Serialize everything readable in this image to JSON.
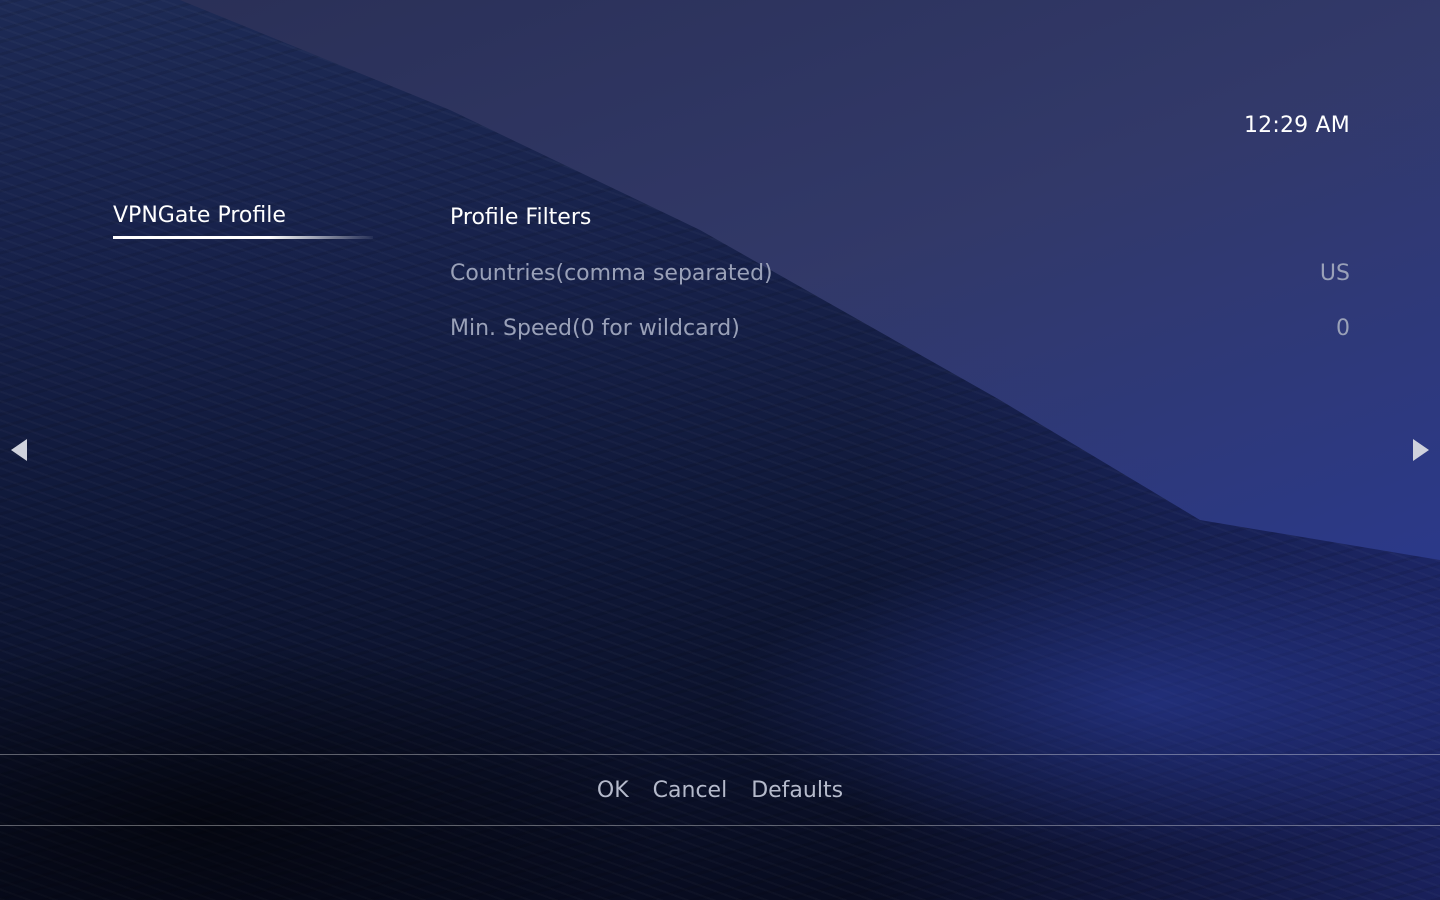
{
  "status": {
    "clock": "12:29 AM"
  },
  "categories": [
    {
      "label": "VPNGate Profile",
      "selected": true
    }
  ],
  "settings": {
    "section_title": "Profile Filters",
    "rows": [
      {
        "label": "Countries(comma separated)",
        "value": "US"
      },
      {
        "label": "Min. Speed(0 for wildcard)",
        "value": "0"
      }
    ]
  },
  "nav": {
    "left_icon": "arrow-left-icon",
    "right_icon": "arrow-right-icon"
  },
  "buttons": {
    "ok": "OK",
    "cancel": "Cancel",
    "defaults": "Defaults"
  },
  "colors": {
    "text_primary": "#ffffff",
    "text_secondary": "#9aa1b8",
    "accent_blue": "#2636a0"
  }
}
